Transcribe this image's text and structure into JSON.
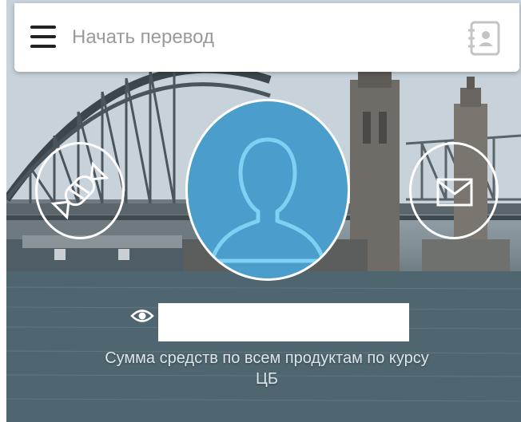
{
  "search": {
    "placeholder": "Начать перевод"
  },
  "balance": {
    "caption": "Сумма средств по всем продуктам по курсу ЦБ"
  },
  "icons": {
    "menu": "hamburger-icon",
    "contacts": "contacts-book-icon",
    "candy": "candy-icon",
    "mail": "envelope-icon",
    "avatar": "user-silhouette-icon",
    "eye": "eye-icon"
  },
  "colors": {
    "avatar_bg": "#4b9dcb",
    "avatar_outline": "#7fd0f2",
    "placeholder_text": "#9a9a9a"
  }
}
